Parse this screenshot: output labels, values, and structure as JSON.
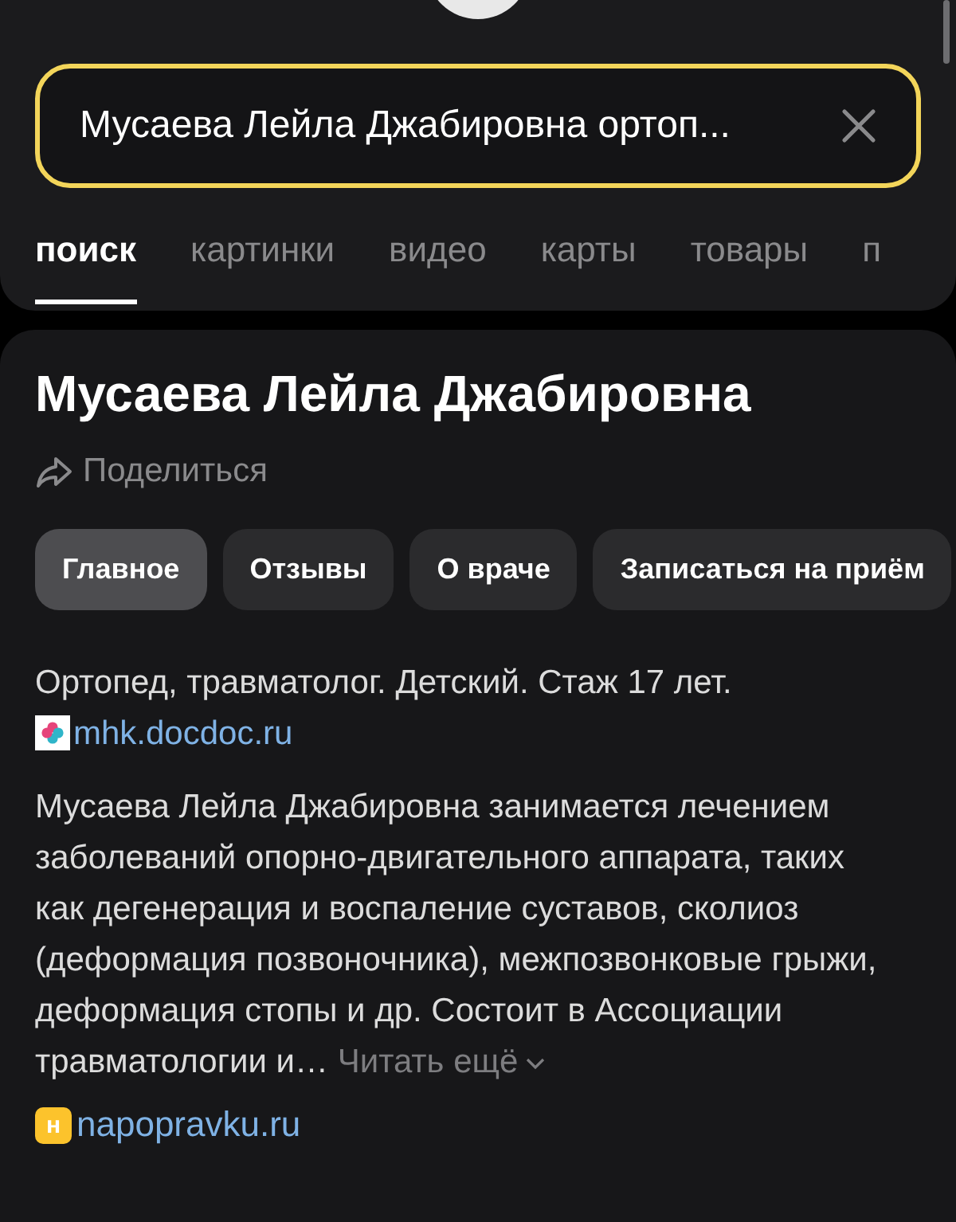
{
  "search": {
    "value": "Мусаева Лейла Джабировна ортоп..."
  },
  "tabs": [
    {
      "label": "поиск",
      "selected": true
    },
    {
      "label": "картинки",
      "selected": false
    },
    {
      "label": "видео",
      "selected": false
    },
    {
      "label": "карты",
      "selected": false
    },
    {
      "label": "товары",
      "selected": false
    },
    {
      "label": "п",
      "selected": false
    }
  ],
  "result": {
    "title": "Мусаева Лейла Джабировна",
    "share": "Поделиться",
    "chips": [
      {
        "label": "Главное",
        "selected": true
      },
      {
        "label": "Отзывы",
        "selected": false
      },
      {
        "label": "О враче",
        "selected": false
      },
      {
        "label": "Записаться на приём",
        "selected": false
      }
    ],
    "summary": "Ортопед, травматолог. Детский. Стаж 17 лет.",
    "summary_source": "mhk.docdoc.ru",
    "description": "Мусаева Лейла Джабировна занимается лечением заболеваний опорно-двигательного аппарата, таких как дегенерация и воспаление суставов, сколиоз (деформация позвоночника), межпозвонковые грыжи, деформация стопы и др. Состоит в Ассоциации травматологии и…",
    "read_more": "Читать ещё",
    "source_letter": "н",
    "source": "napopravku.ru"
  }
}
